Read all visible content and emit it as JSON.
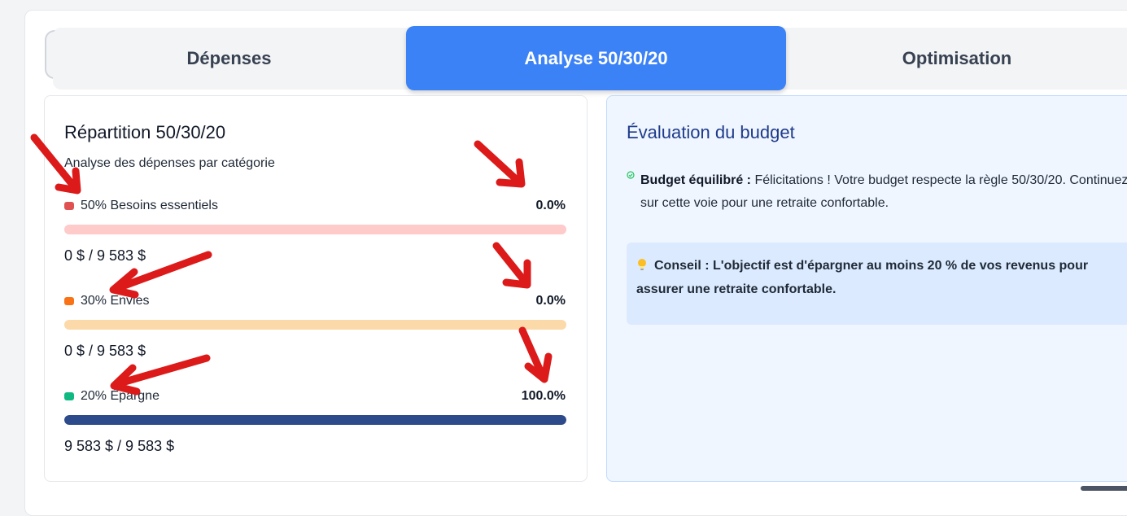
{
  "tabs": [
    {
      "label": "Dépenses",
      "active": false
    },
    {
      "label": "Analyse 50/30/20",
      "active": true
    },
    {
      "label": "Optimisation",
      "active": false
    }
  ],
  "breakdown": {
    "title": "Répartition 50/30/20",
    "subtitle": "Analyse des dépenses par catégorie",
    "categories": [
      {
        "label": "50% Besoins essentiels",
        "percent_text": "0.0%",
        "percent": 0.0,
        "amount": "0 $ / 9 583 $",
        "dot_color": "#e05252",
        "track_color": "#fecaca",
        "fill_color": "#fecaca"
      },
      {
        "label": "30% Envies",
        "percent_text": "0.0%",
        "percent": 0.0,
        "amount": "0 $ / 9 583 $",
        "dot_color": "#f97316",
        "track_color": "#fcd9a8",
        "fill_color": "#fcd9a8"
      },
      {
        "label": "20% Épargne",
        "percent_text": "100.0%",
        "percent": 100.0,
        "amount": "9 583 $ / 9 583 $",
        "dot_color": "#10b981",
        "track_color": "#dbe3f3",
        "fill_color": "#2d4a8a"
      }
    ]
  },
  "evaluation": {
    "title": "Évaluation du budget",
    "status_label": "Budget équilibré :",
    "status_text": "Félicitations ! Votre budget respecte la règle 50/30/20. Continuez sur cette voie pour une retraite confortable.",
    "tip_label": "Conseil :",
    "tip_text": "L'objectif est d'épargner au moins 20 % de vos revenus pour assurer une retraite confortable."
  },
  "colors": {
    "accent": "#3b82f6",
    "annotation_arrow": "#dc1a1a",
    "eval_title": "#1e3a8a"
  }
}
